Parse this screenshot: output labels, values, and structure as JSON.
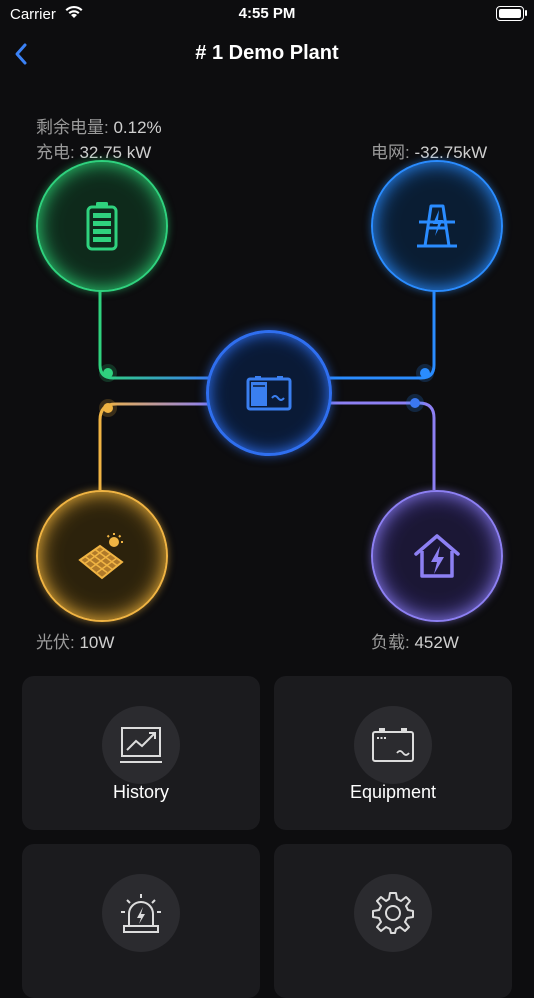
{
  "status_bar": {
    "carrier": "Carrier",
    "time": "4:55 PM"
  },
  "nav": {
    "title": "# 1 Demo Plant"
  },
  "flow": {
    "battery": {
      "soc_label": "剩余电量",
      "soc_value": "0.12%",
      "charge_label": "充电",
      "charge_value": "32.75 kW",
      "color": "#2fd27e"
    },
    "grid": {
      "label": "电网",
      "value": "-32.75kW",
      "color": "#2a8cff"
    },
    "pv": {
      "label": "光伏",
      "value": "10W",
      "color": "#f0b443"
    },
    "load": {
      "label": "负载",
      "value": "452W",
      "color": "#8d80f3"
    },
    "inverter": {
      "color": "#2f6ff0"
    }
  },
  "menu": [
    {
      "label": "History",
      "icon": "chart-icon"
    },
    {
      "label": "Equipment",
      "icon": "inverter-icon"
    },
    {
      "label": "",
      "icon": "alarm-icon"
    },
    {
      "label": "",
      "icon": "gear-icon"
    }
  ]
}
